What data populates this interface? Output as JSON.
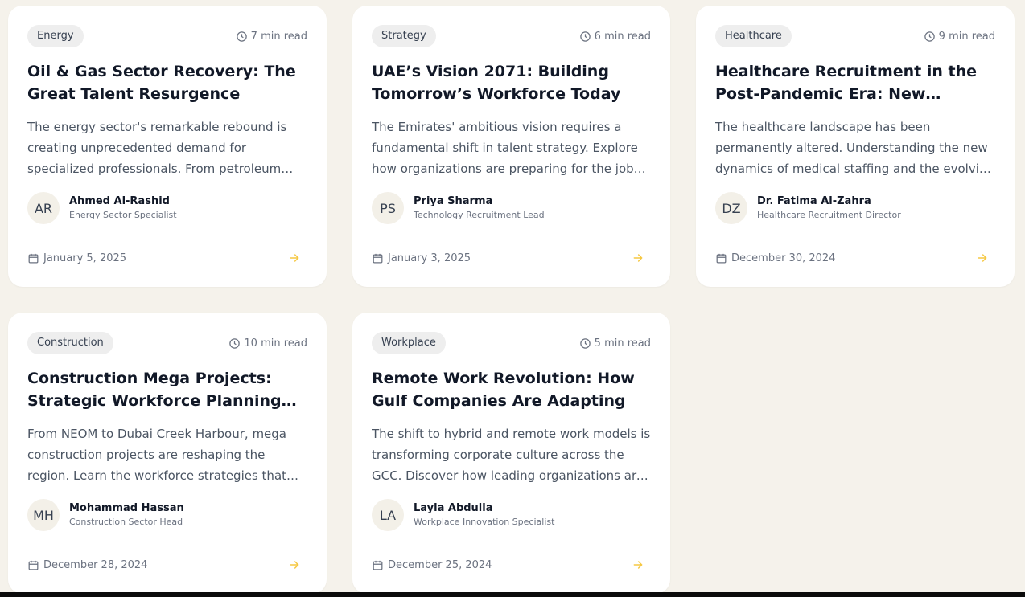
{
  "colors": {
    "background": "#f5f2eb",
    "card": "#ffffff",
    "tag_bg": "#eeeeee",
    "accent_arrow": "#f5c842",
    "avatar_bg": "#f3f0e8"
  },
  "icons": {
    "read_time": "clock-icon",
    "date": "calendar-icon",
    "read_more": "arrow-right-icon"
  },
  "articles": [
    {
      "category": "Energy",
      "read_time": "7 min read",
      "title": "Oil & Gas Sector Recovery: The Great Talent Resurgence",
      "excerpt": "The energy sector's remarkable rebound is creating unprecedented demand for specialized professionals. From petroleum engineers to sustainability experts, discover the roles shaping the future.",
      "author_initials": "AR",
      "author_name": "Ahmed Al-Rashid",
      "author_role": "Energy Sector Specialist",
      "date": "January 5, 2025"
    },
    {
      "category": "Strategy",
      "read_time": "6 min read",
      "title": "UAE’s Vision 2071: Building Tomorrow’s Workforce Today",
      "excerpt": "The Emirates' ambitious vision requires a fundamental shift in talent strategy. Explore how organizations are preparing for the jobs of tomorrow.",
      "author_initials": "PS",
      "author_name": "Priya Sharma",
      "author_role": "Technology Recruitment Lead",
      "date": "January 3, 2025"
    },
    {
      "category": "Healthcare",
      "read_time": "9 min read",
      "title": "Healthcare Recruitment in the Post-Pandemic Era: New Realities",
      "excerpt": "The healthcare landscape has been permanently altered. Understanding the new dynamics of medical staffing and the evolving needs of providers.",
      "author_initials": "DZ",
      "author_name": "Dr. Fatima Al-Zahra",
      "author_role": "Healthcare Recruitment Director",
      "date": "December 30, 2024"
    },
    {
      "category": "Construction",
      "read_time": "10 min read",
      "title": "Construction Mega Projects: Strategic Workforce Planning for the Future",
      "excerpt": "From NEOM to Dubai Creek Harbour, mega construction projects are reshaping the region. Learn the workforce strategies that determine success.",
      "author_initials": "MH",
      "author_name": "Mohammad Hassan",
      "author_role": "Construction Sector Head",
      "date": "December 28, 2024"
    },
    {
      "category": "Workplace",
      "read_time": "5 min read",
      "title": "Remote Work Revolution: How Gulf Companies Are Adapting",
      "excerpt": "The shift to hybrid and remote work models is transforming corporate culture across the GCC. Discover how leading organizations are adapting.",
      "author_initials": "LA",
      "author_name": "Layla Abdulla",
      "author_role": "Workplace Innovation Specialist",
      "date": "December 25, 2024"
    }
  ]
}
